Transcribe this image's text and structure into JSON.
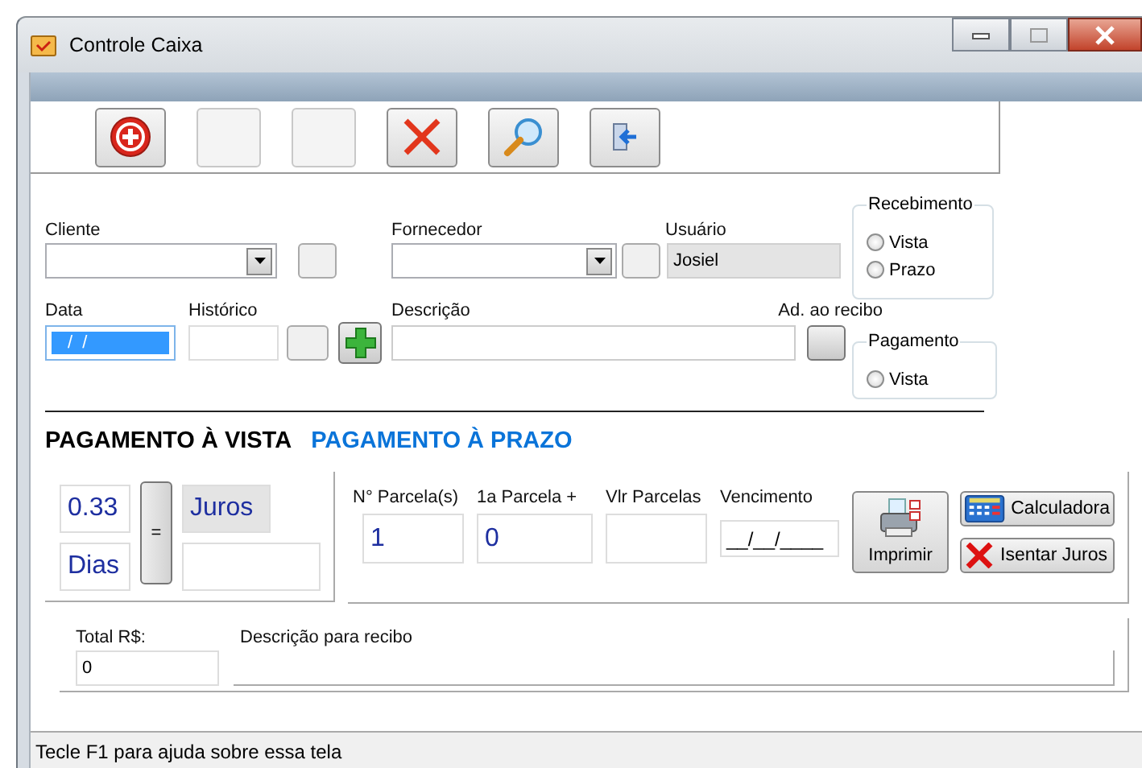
{
  "window": {
    "title": "Controle Caixa"
  },
  "toolbar": [
    {
      "kind": "add"
    },
    {
      "kind": "blank"
    },
    {
      "kind": "blank"
    },
    {
      "kind": "delete"
    },
    {
      "kind": "search"
    },
    {
      "kind": "exit"
    }
  ],
  "cliente": {
    "label": "Cliente"
  },
  "fornecedor": {
    "label": "Fornecedor"
  },
  "usuario": {
    "label": "Usuário",
    "value": "Josiel",
    "readonly": true
  },
  "data": {
    "label": "Data",
    "value": "/  /",
    "highlighted": true
  },
  "historico": {
    "label": "Histórico"
  },
  "descricao": {
    "label": "Descrição"
  },
  "ad_recibo": {
    "label": "Ad. ao recibo"
  },
  "recebimento": {
    "title": "Recebimento",
    "options": [
      {
        "label": "Vista",
        "selected": false
      },
      {
        "label": "Prazo",
        "selected": false
      }
    ]
  },
  "pagamento": {
    "title": "Pagamento",
    "options": [
      {
        "label": "Vista",
        "selected": false
      }
    ]
  },
  "sections": [
    {
      "label": "PAGAMENTO À VISTA",
      "selected": true
    },
    {
      "label": "PAGAMENTO À PRAZO",
      "selected": false
    }
  ],
  "vista": {
    "rate": "0.33",
    "days": "Dias",
    "equals": "=",
    "interest": {
      "value": "Juros",
      "readonly": true
    }
  },
  "prazo": {
    "columns": [
      {
        "label": "N° Parcela(s)",
        "value": "1"
      },
      {
        "label": "1a Parcela  +",
        "value": "0"
      },
      {
        "label": "Vlr Parcelas"
      },
      {
        "label": "Vencimento",
        "value": "__/__/____"
      }
    ],
    "buttons": [
      {
        "kind": "print",
        "label": "Imprimir"
      },
      {
        "kind": "calculator",
        "label": "Calculadora"
      },
      {
        "kind": "exempt",
        "label": "Isentar Juros"
      }
    ]
  },
  "total": {
    "label": "Total R$:",
    "value": "0"
  },
  "recibo": {
    "label": "Descrição para recibo"
  },
  "status_bar": "Tecle F1 para ajuda sobre essa tela"
}
